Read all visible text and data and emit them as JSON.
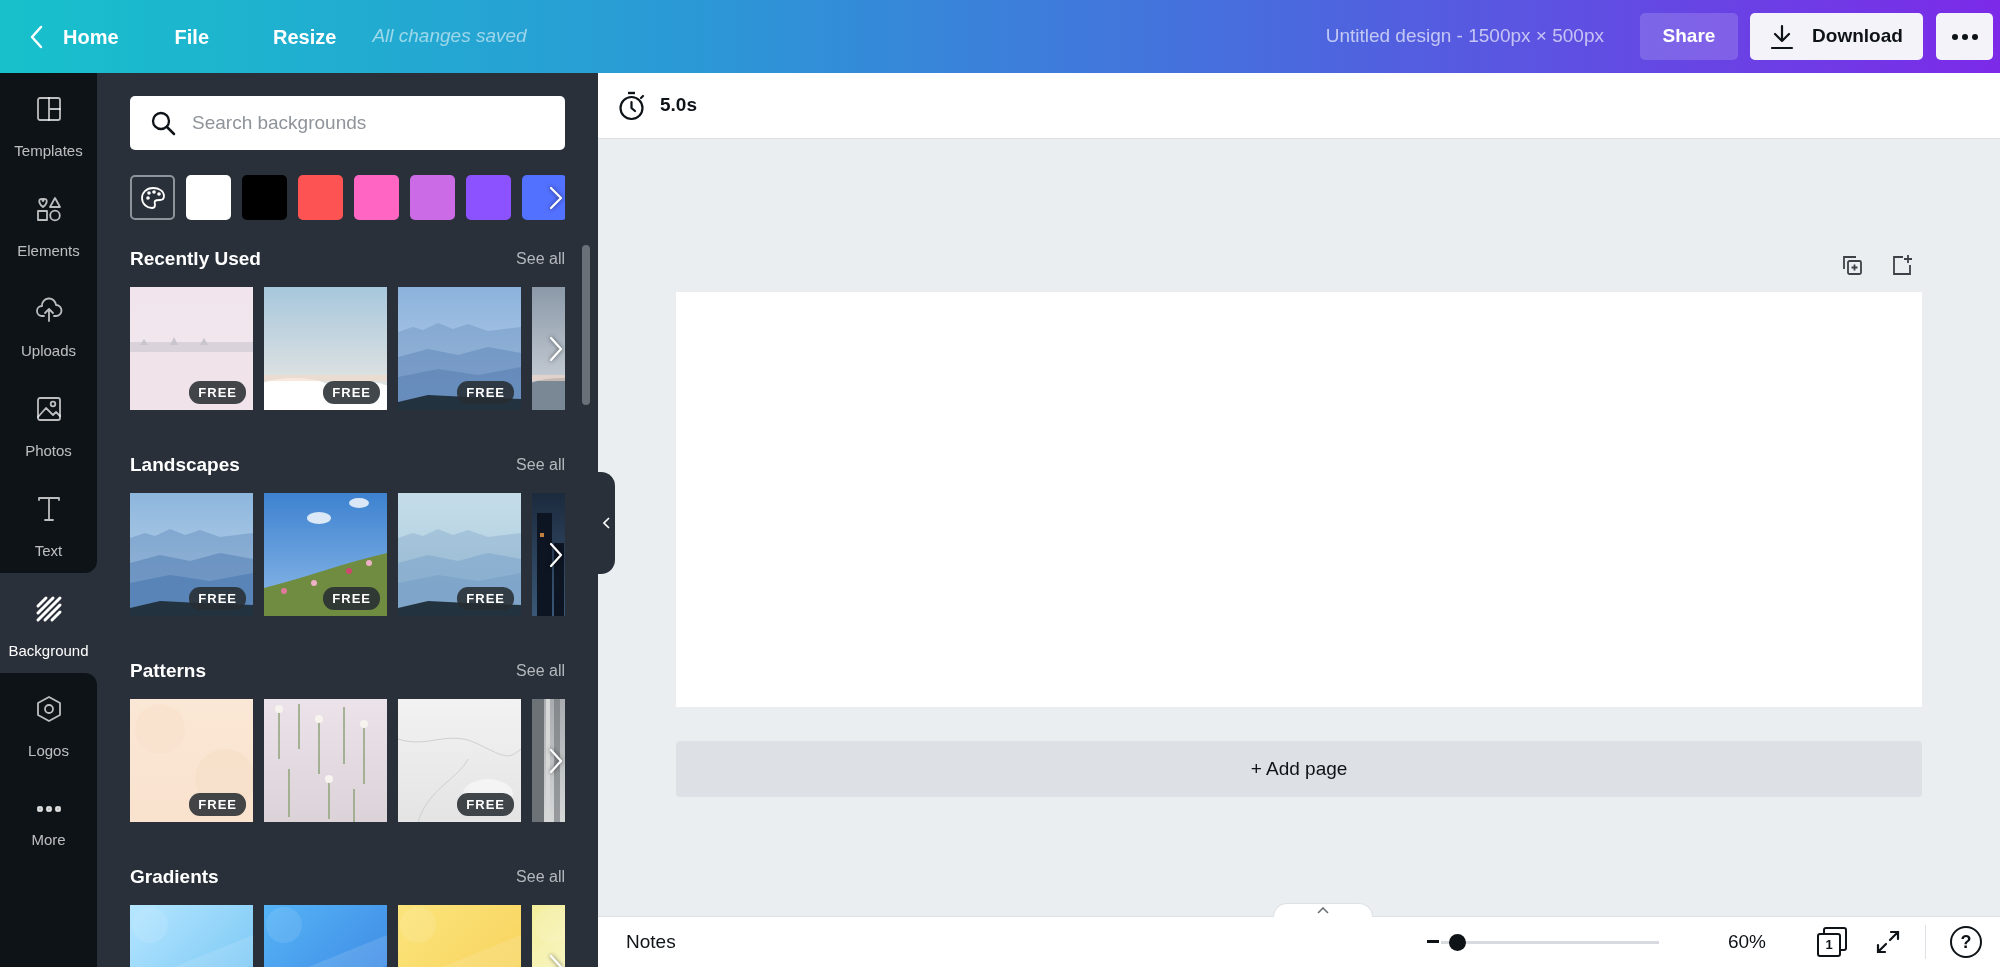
{
  "top_bar": {
    "back": "Home",
    "menu": [
      "File",
      "Resize"
    ],
    "save_status": "All changes saved",
    "design_title": "Untitled design - 1500px × 500px",
    "share": "Share",
    "download": "Download"
  },
  "sidebar": {
    "items": [
      {
        "label": "Templates",
        "selected": false
      },
      {
        "label": "Elements",
        "selected": false
      },
      {
        "label": "Uploads",
        "selected": false
      },
      {
        "label": "Photos",
        "selected": false
      },
      {
        "label": "Text",
        "selected": false
      },
      {
        "label": "Background",
        "selected": true
      },
      {
        "label": "Logos",
        "selected": false
      },
      {
        "label": "More",
        "selected": false
      }
    ]
  },
  "panel": {
    "search": {
      "placeholder": "Search backgrounds"
    },
    "swatches": [
      {
        "kind": "palette"
      },
      {
        "kind": "color",
        "color": "#ffffff"
      },
      {
        "kind": "color",
        "color": "#000000"
      },
      {
        "kind": "color",
        "color": "#fd5353"
      },
      {
        "kind": "color",
        "color": "#ff66c4"
      },
      {
        "kind": "color",
        "color": "#cb6ce6"
      },
      {
        "kind": "color",
        "color": "#8c52ff"
      },
      {
        "kind": "color",
        "color": "#5271ff"
      }
    ],
    "sections": [
      {
        "title": "Recently Used",
        "see_all": "See all",
        "thumbnails": [
          {
            "kind": "picture",
            "badge": "FREE"
          },
          {
            "kind": "picture",
            "badge": "FREE"
          },
          {
            "kind": "picture",
            "badge": "FREE"
          },
          {
            "kind": "picture"
          }
        ]
      },
      {
        "title": "Landscapes",
        "see_all": "See all",
        "thumbnails": [
          {
            "kind": "picture",
            "badge": "FREE"
          },
          {
            "kind": "picture",
            "badge": "FREE"
          },
          {
            "kind": "picture",
            "badge": "FREE"
          },
          {
            "kind": "picture"
          }
        ]
      },
      {
        "title": "Patterns",
        "see_all": "See all",
        "thumbnails": [
          {
            "kind": "picture",
            "badge": "FREE"
          },
          {
            "kind": "picture"
          },
          {
            "kind": "picture",
            "badge": "FREE"
          },
          {
            "kind": "picture"
          }
        ]
      },
      {
        "title": "Gradients",
        "see_all": "See all",
        "thumbnails": [
          {
            "kind": "picture"
          },
          {
            "kind": "picture"
          },
          {
            "kind": "picture"
          },
          {
            "kind": "picture"
          }
        ]
      }
    ]
  },
  "timer": "5.0s",
  "canvas": {
    "add_page": "+ Add page"
  },
  "bottom_bar": {
    "notes": "Notes",
    "zoom": {
      "level": 0.05
    },
    "zoom_label": "60%",
    "page_count": "1",
    "help": "?"
  }
}
